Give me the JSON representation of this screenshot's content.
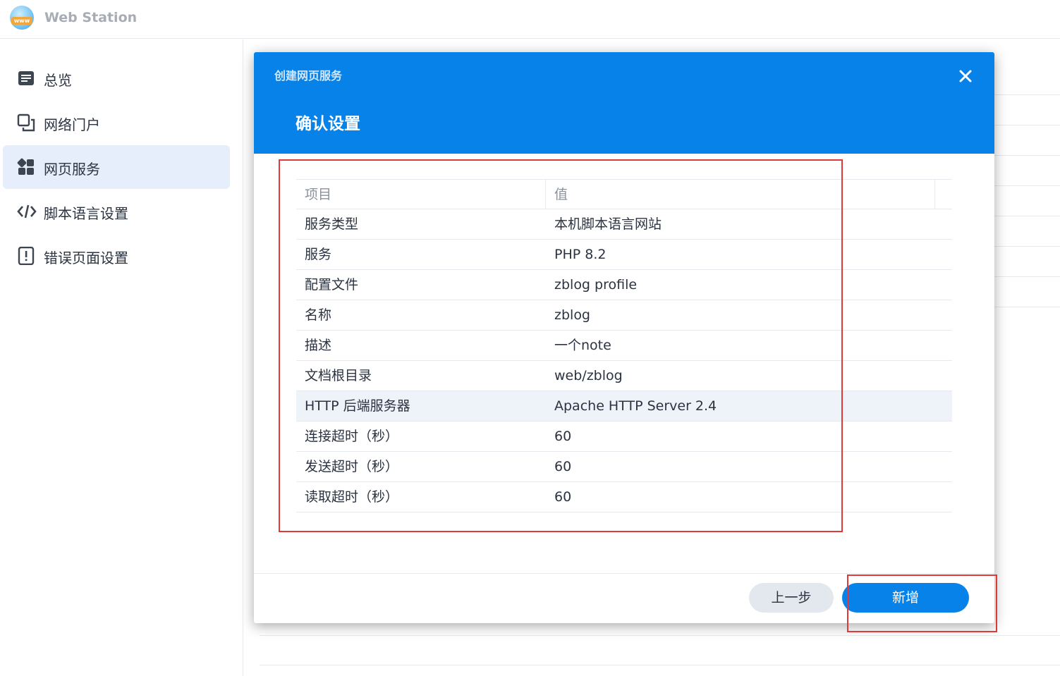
{
  "app": {
    "title": "Web Station",
    "logo_text": "www"
  },
  "sidebar": {
    "items": [
      {
        "label": "总览",
        "icon": "overview-icon",
        "active": false
      },
      {
        "label": "网络门户",
        "icon": "web-portal-icon",
        "active": false
      },
      {
        "label": "网页服务",
        "icon": "web-service-icon",
        "active": true
      },
      {
        "label": "脚本语言设置",
        "icon": "code-icon",
        "active": false
      },
      {
        "label": "错误页面设置",
        "icon": "error-page-icon",
        "active": false
      }
    ]
  },
  "modal": {
    "small_title": "创建网页服务",
    "step_title": "确认设置",
    "close_icon": "close-icon",
    "table": {
      "headers": [
        "项目",
        "值"
      ],
      "rows": [
        {
          "key": "服务类型",
          "value": "本机脚本语言网站"
        },
        {
          "key": "服务",
          "value": "PHP 8.2"
        },
        {
          "key": "配置文件",
          "value": "zblog profile"
        },
        {
          "key": "名称",
          "value": "zblog"
        },
        {
          "key": "描述",
          "value": "一个note"
        },
        {
          "key": "文档根目录",
          "value": "web/zblog"
        },
        {
          "key": "HTTP 后端服务器",
          "value": "Apache HTTP Server 2.4"
        },
        {
          "key": "连接超时（秒）",
          "value": "60"
        },
        {
          "key": "发送超时（秒）",
          "value": "60"
        },
        {
          "key": "读取超时（秒）",
          "value": "60"
        }
      ]
    },
    "buttons": {
      "back": "上一步",
      "add": "新增"
    }
  },
  "colors": {
    "primary": "#0782e8",
    "active_bg": "#e6eefb",
    "annotation": "#e0393a"
  }
}
